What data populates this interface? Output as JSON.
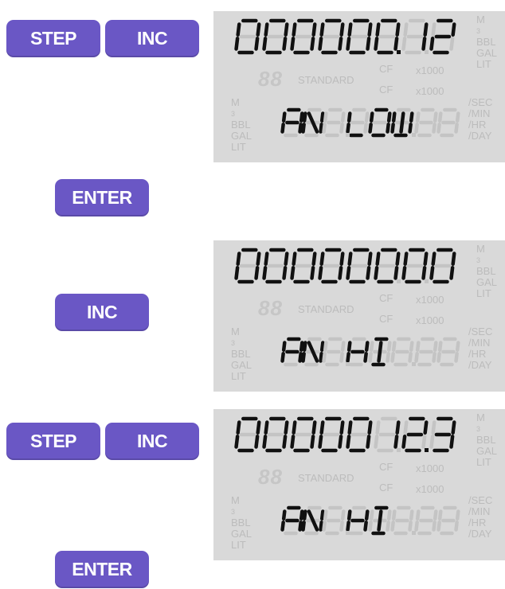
{
  "buttons": {
    "step": "STEP",
    "inc": "INC",
    "enter": "ENTER"
  },
  "panels": [
    {
      "top_text": "000000.12",
      "bottom_text": "AN LOW"
    },
    {
      "top_text": "00000000",
      "bottom_text": "AN HI"
    },
    {
      "top_text": "0000012.3",
      "bottom_text": "AN HI"
    }
  ],
  "lcd_labels": {
    "units_top": [
      "M3",
      "BBL",
      "GAL",
      "LIT"
    ],
    "units_left": [
      "M3",
      "BBL",
      "GAL",
      "LIT"
    ],
    "rates": [
      "/SEC",
      "/MIN",
      "/HR",
      "/DAY"
    ],
    "standard": "STANDARD",
    "cf": "CF",
    "x1000": "x1000",
    "eighty_eight": "88"
  },
  "colors": {
    "button": "#6a57c5",
    "lcd_background": "#d9d9d9",
    "segment_on": "#111111",
    "segment_ghost": "#c4c4c4"
  }
}
